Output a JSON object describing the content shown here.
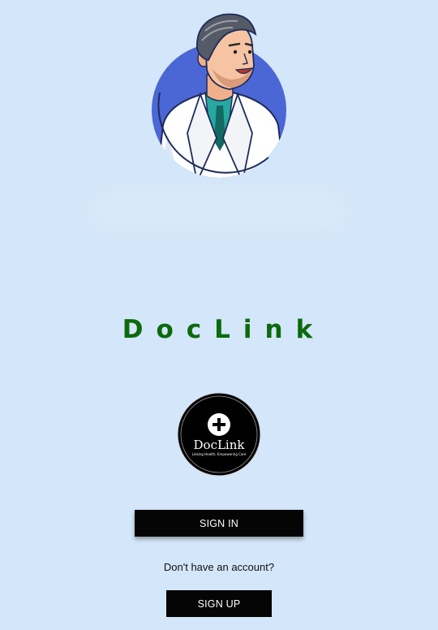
{
  "illustration": {
    "name": "doctor-avatar"
  },
  "app": {
    "title": "DocLink"
  },
  "logo": {
    "name": "DocLink",
    "tagline": "Linking Health, Empowering Care"
  },
  "actions": {
    "sign_in": "SIGN IN",
    "signup_prompt": "Don't have an account?",
    "sign_up": "SIGN UP"
  },
  "colors": {
    "background": "#d4e6f9",
    "title": "#0b6a0b",
    "button": "#050505",
    "button_text": "#ffffff",
    "avatar_circle": "#4b67d6"
  }
}
